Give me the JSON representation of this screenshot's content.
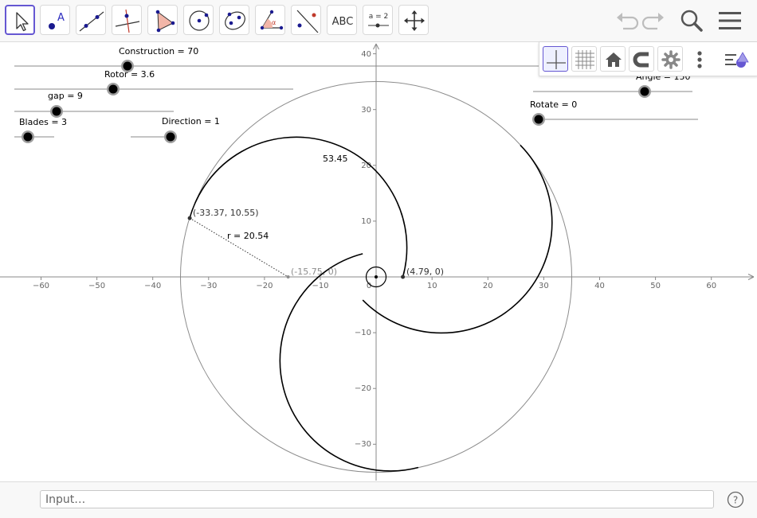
{
  "toolbar": {
    "tools": [
      {
        "name": "move-tool",
        "icon": "arrow-cursor-icon"
      },
      {
        "name": "point-tool",
        "icon": "point-icon"
      },
      {
        "name": "line-tool",
        "icon": "line-icon"
      },
      {
        "name": "perpendicular-tool",
        "icon": "perpendicular-line-icon"
      },
      {
        "name": "polygon-tool",
        "icon": "polygon-icon"
      },
      {
        "name": "circle-tool",
        "icon": "circle-icon"
      },
      {
        "name": "ellipse-tool",
        "icon": "ellipse-icon"
      },
      {
        "name": "angle-tool",
        "icon": "angle-icon"
      },
      {
        "name": "reflect-tool",
        "icon": "reflect-icon"
      },
      {
        "name": "text-tool",
        "icon": "text-icon",
        "label": "ABC"
      },
      {
        "name": "slider-tool",
        "icon": "slider-icon",
        "label": "a = 2"
      },
      {
        "name": "move-graphics-tool",
        "icon": "move-graphics-icon"
      }
    ],
    "actions": [
      "undo-icon",
      "redo-icon",
      "search-icon",
      "menu-icon"
    ]
  },
  "style_bar": {
    "buttons": [
      "axes-icon",
      "grid-icon",
      "home-icon",
      "magnet-icon",
      "gear-icon",
      "more-vertical-icon"
    ],
    "toggle_icon": "style-bar-toggle-icon"
  },
  "sliders": {
    "construction": {
      "label": "Construction = 70",
      "value": 70
    },
    "rotor": {
      "label": "Rotor = 3.6",
      "value": 3.6
    },
    "gap": {
      "label": "gap = 9",
      "value": 9
    },
    "blades": {
      "label": "Blades = 3",
      "value": 3
    },
    "direction": {
      "label": "Direction = 1",
      "value": 1
    },
    "angle": {
      "label": "Angle = 150",
      "value": 150
    },
    "rotate": {
      "label": "Rotate = 0",
      "value": 0
    }
  },
  "graph": {
    "x_ticks": [
      "−60",
      "−50",
      "−40",
      "−30",
      "−20",
      "−10",
      "0",
      "10",
      "20",
      "30",
      "40",
      "50",
      "60"
    ],
    "y_ticks": [
      "40",
      "30",
      "20",
      "10",
      "−10",
      "−20",
      "−30"
    ],
    "annotations": {
      "arc_length": "53.45",
      "point_a": "(-33.37, 10.55)",
      "radius": "r = 20.54",
      "center": "(-15.75, 0)",
      "point_b": "(4.79, 0)"
    }
  },
  "input_bar": {
    "placeholder": "Input…"
  },
  "colors": {
    "accent": "#6557d2",
    "curve": "#000000",
    "circle": "#8c8c8c",
    "axis": "#888888"
  }
}
